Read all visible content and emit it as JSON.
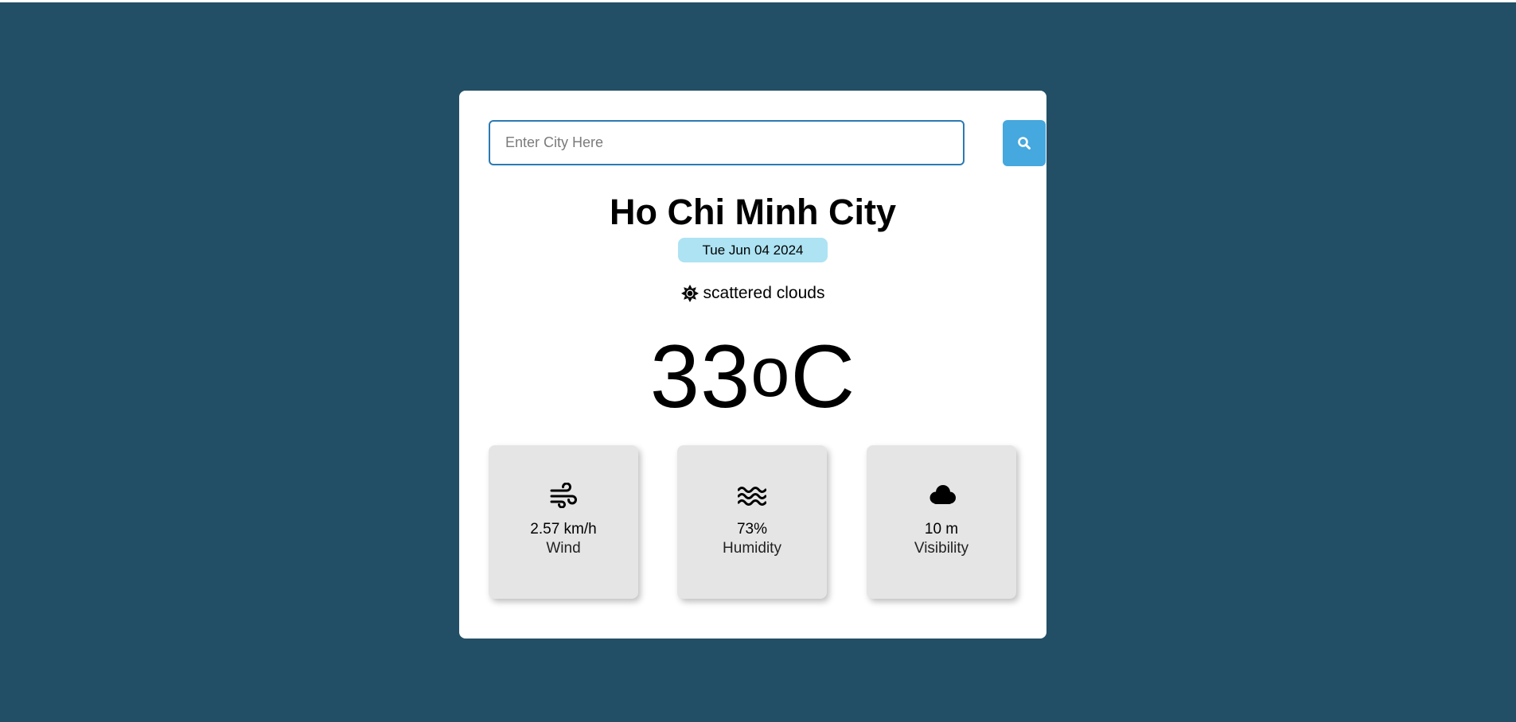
{
  "search": {
    "placeholder": "Enter City Here",
    "value": "",
    "button_icon": "search-icon"
  },
  "weather": {
    "city": "Ho Chi Minh City",
    "date": "Tue Jun 04 2024",
    "condition_icon": "sun-icon",
    "condition": "scattered clouds",
    "temperature": "33",
    "unit_degree": "o",
    "unit": "C"
  },
  "stats": [
    {
      "icon": "wind-icon",
      "value": "2.57 km/h",
      "label": "Wind"
    },
    {
      "icon": "water-icon",
      "value": "73%",
      "label": "Humidity"
    },
    {
      "icon": "cloud-icon",
      "value": "10 m",
      "label": "Visibility"
    }
  ],
  "colors": {
    "background": "#234f66",
    "card": "#ffffff",
    "accent": "#45a8de",
    "date_badge": "#ade3f3",
    "stat_card": "#e5e5e5"
  }
}
